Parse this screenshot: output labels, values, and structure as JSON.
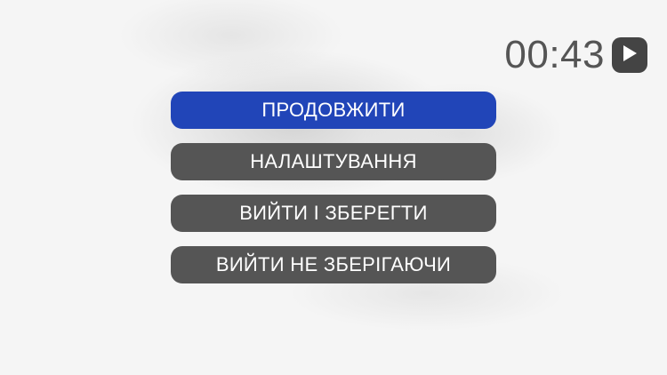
{
  "timer": {
    "time": "00:43",
    "play_icon": "play-icon"
  },
  "menu": {
    "buttons": [
      {
        "label": "ПРОДОВЖИТИ",
        "primary": true
      },
      {
        "label": "НАЛАШТУВАННЯ",
        "primary": false
      },
      {
        "label": "ВИЙТИ І ЗБЕРЕГТИ",
        "primary": false
      },
      {
        "label": "ВИЙТИ НЕ ЗБЕРІГАЮЧИ",
        "primary": false
      }
    ]
  },
  "colors": {
    "primary_button": "#2145b8",
    "secondary_button": "#555555",
    "timer_text": "#555555"
  }
}
